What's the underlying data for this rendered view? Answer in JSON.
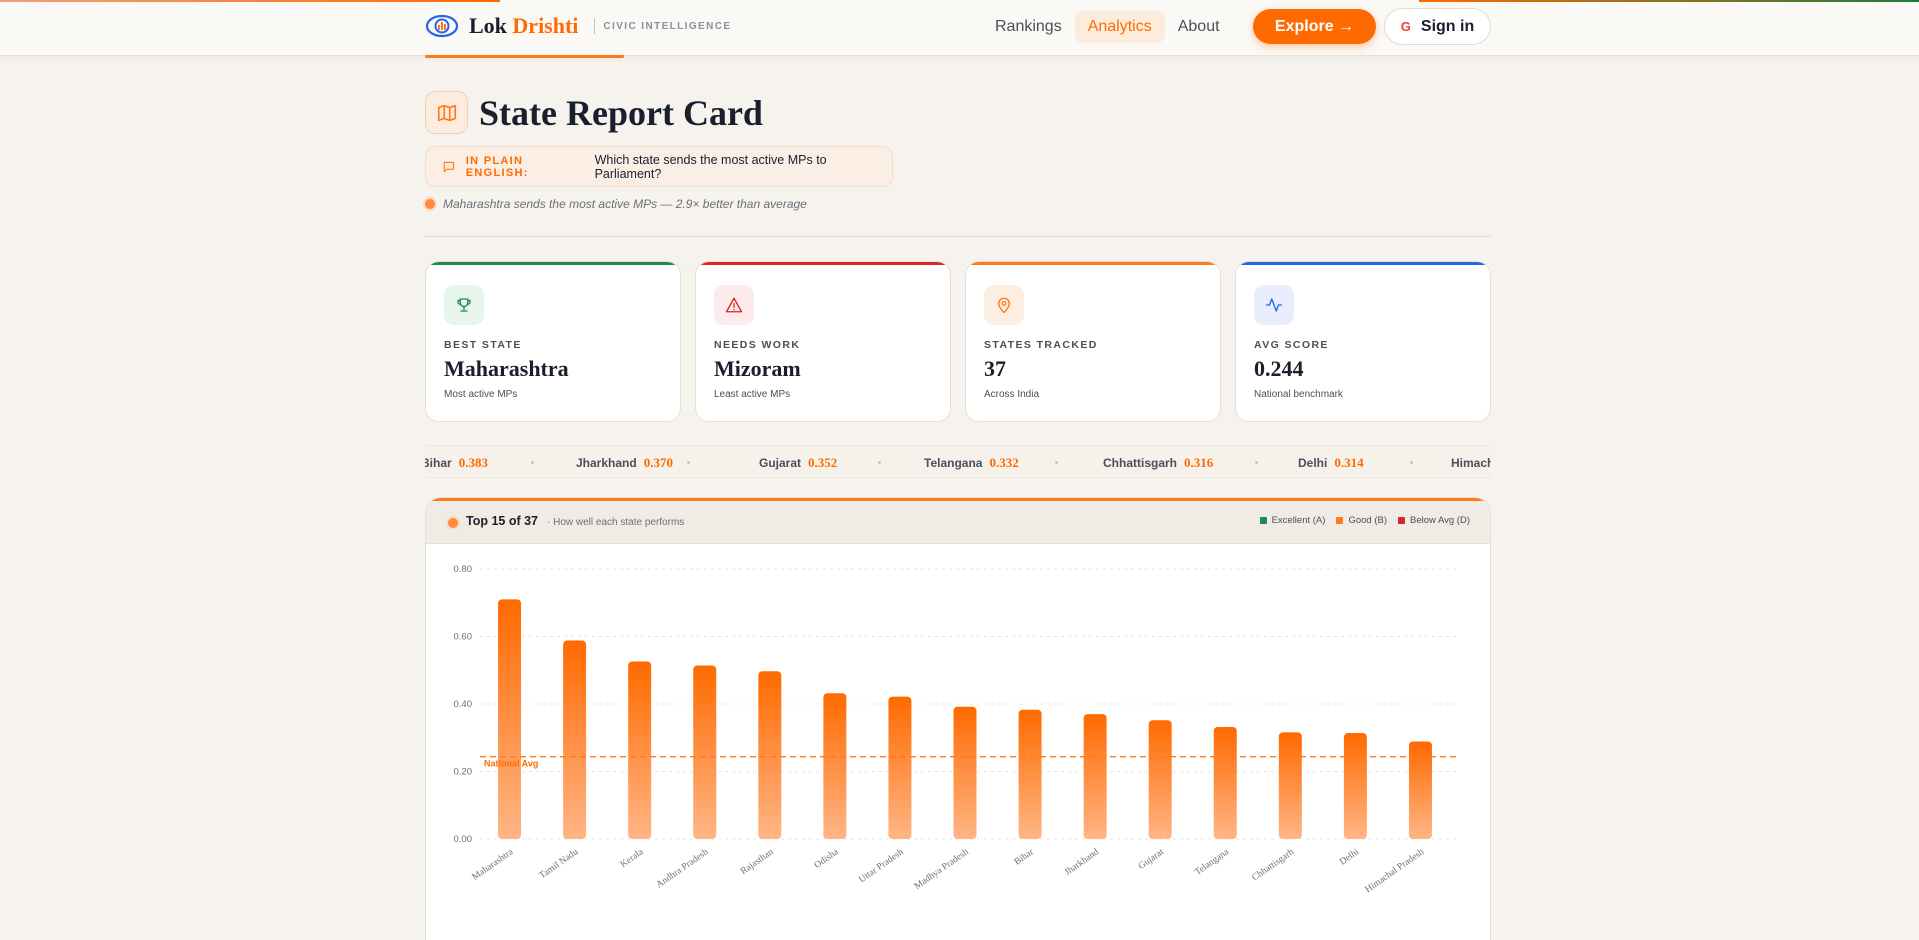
{
  "header": {
    "brand_first": "Lok",
    "brand_second": "Drishti",
    "tagline": "CIVIC INTELLIGENCE",
    "nav": [
      "Rankings",
      "Analytics",
      "About"
    ],
    "active_nav": "Analytics",
    "explore_label": "Explore →",
    "signin_label": "Sign in",
    "google_glyph": "G"
  },
  "page": {
    "title": "State Report Card",
    "title_icon": "map-icon",
    "plain_label": "IN PLAIN ENGLISH:",
    "plain_text": "Which state sends the most active MPs to Parliament?",
    "insight": "Maharashtra sends the most active MPs — 2.9× better than average"
  },
  "cards": [
    {
      "label": "BEST STATE",
      "value": "Maharashtra",
      "sub": "Most active MPs",
      "icon": "trophy-icon",
      "color": "#1d8a52",
      "bg": "#e7f5ed"
    },
    {
      "label": "NEEDS WORK",
      "value": "Mizoram",
      "sub": "Least active MPs",
      "icon": "alert-triangle-icon",
      "color": "#dc2626",
      "bg": "#fdeaea"
    },
    {
      "label": "STATES TRACKED",
      "value": "37",
      "sub": "Across India",
      "icon": "map-pin-icon",
      "color": "#ff7a1a",
      "bg": "#fdeee2"
    },
    {
      "label": "AVG SCORE",
      "value": "0.244",
      "sub": "National benchmark",
      "icon": "activity-icon",
      "color": "#2563eb",
      "bg": "#e8eefd"
    }
  ],
  "ticker": [
    {
      "name": "Bihar",
      "value": "0.383"
    },
    {
      "name": "Jharkhand",
      "value": "0.370"
    },
    {
      "name": "Gujarat",
      "value": "0.352"
    },
    {
      "name": "Telangana",
      "value": "0.332"
    },
    {
      "name": "Chhattisgarh",
      "value": "0.316"
    },
    {
      "name": "Delhi",
      "value": "0.314"
    },
    {
      "name": "Himach",
      "value": ""
    }
  ],
  "panel": {
    "title": "Top 15 of 37",
    "subtitle": "· How well each state performs",
    "legend": [
      {
        "label": "Excellent (A)",
        "color": "#1d8a52"
      },
      {
        "label": "Good (B)",
        "color": "#ff7a1a"
      },
      {
        "label": "Below Avg (D)",
        "color": "#dc2626"
      }
    ]
  },
  "chart_data": {
    "type": "bar",
    "categories": [
      "Maharashtra",
      "Tamil Nadu",
      "Kerala",
      "Andhra Pradesh",
      "Rajasthan",
      "Odisha",
      "Uttar Pradesh",
      "Madhya Pradesh",
      "Bihar",
      "Jharkhand",
      "Gujarat",
      "Telangana",
      "Chhattisgarh",
      "Delhi",
      "Himachal Pradesh"
    ],
    "values": [
      0.71,
      0.588,
      0.526,
      0.514,
      0.497,
      0.432,
      0.422,
      0.392,
      0.383,
      0.37,
      0.352,
      0.332,
      0.316,
      0.314,
      0.289
    ],
    "ylim": [
      0,
      0.8
    ],
    "yticks": [
      "0.00",
      "0.20",
      "0.40",
      "0.60",
      "0.80"
    ],
    "reference_line": {
      "label": "National Avg",
      "value": 0.244
    },
    "grid": true,
    "bar_color": "#ff7a1a"
  }
}
